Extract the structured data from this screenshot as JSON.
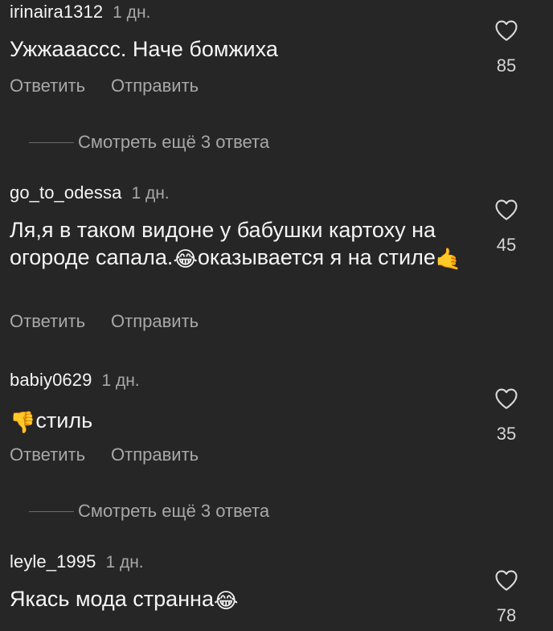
{
  "comments": [
    {
      "username": "irinaira1312",
      "time": "1 дн.",
      "text": "Ужжааассс. Наче бомжиха",
      "likes": "85",
      "reply_label": "Ответить",
      "send_label": "Отправить"
    },
    {
      "username": "go_to_odessa",
      "time": "1 дн.",
      "text_part1": "Ля,я в таком видоне у бабушки картоху на огороде сапала.",
      "emoji1": "😂",
      "text_part2": "оказывается я на стиле",
      "emoji2": "🤙",
      "likes": "45",
      "reply_label": "Ответить",
      "send_label": "Отправить"
    },
    {
      "username": "babiy0629",
      "time": "1 дн.",
      "emoji": "👎",
      "text": "стиль",
      "likes": "35",
      "reply_label": "Ответить",
      "send_label": "Отправить"
    },
    {
      "username": "leyle_1995",
      "time": "1 дн.",
      "text": "Якась мода странна",
      "emoji": "😂",
      "likes": "78"
    }
  ],
  "view_replies": [
    {
      "label": "Смотреть ещё 3 ответа"
    },
    {
      "label": "Смотреть ещё 3 ответа"
    }
  ],
  "icons": {
    "like": "heart-outline-icon"
  },
  "colors": {
    "background": "#262626",
    "primary_text": "#f5f5f5",
    "secondary_text": "#a8a8a8"
  }
}
